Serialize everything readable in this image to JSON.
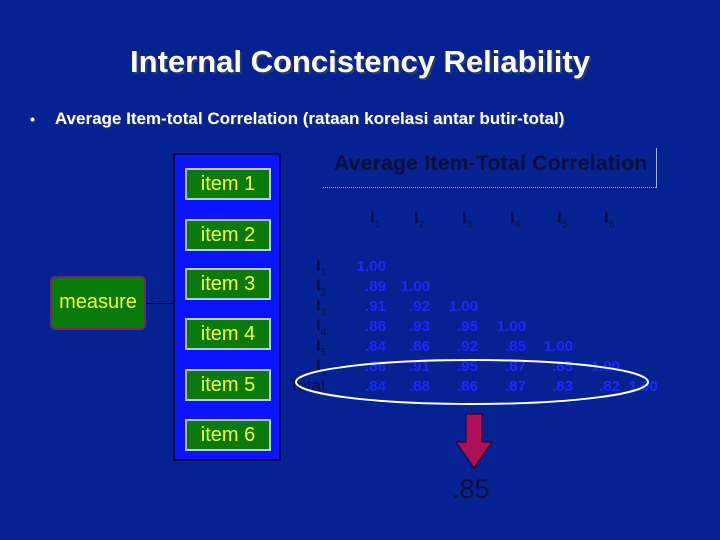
{
  "slide": {
    "title": "Internal Concistency Reliability",
    "bullet_marker": "•",
    "bullet_text": "Average Item-total Correlation (rataan korelasi antar butir-total)"
  },
  "diagram": {
    "measure_label": "measure",
    "items": [
      "item 1",
      "item 2",
      "item 3",
      "item 4",
      "item 5",
      "item 6"
    ]
  },
  "table": {
    "title": "Average Item-Total Correlation",
    "columns": [
      {
        "letter": "I",
        "sub": "1"
      },
      {
        "letter": "I",
        "sub": "2"
      },
      {
        "letter": "I",
        "sub": "3"
      },
      {
        "letter": "I",
        "sub": "4"
      },
      {
        "letter": "I",
        "sub": "5"
      },
      {
        "letter": "I",
        "sub": "6"
      }
    ],
    "rows": [
      {
        "letter": "I",
        "sub": "1",
        "values": [
          "1.00"
        ]
      },
      {
        "letter": "I",
        "sub": "2",
        "values": [
          ".89",
          "1.00"
        ]
      },
      {
        "letter": "I",
        "sub": "3",
        "values": [
          ".91",
          ".92",
          "1.00"
        ]
      },
      {
        "letter": "I",
        "sub": "4",
        "values": [
          ".88",
          ".93",
          ".95",
          "1.00"
        ]
      },
      {
        "letter": "I",
        "sub": "5",
        "values": [
          ".84",
          ".86",
          ".92",
          ".85",
          "1.00"
        ]
      },
      {
        "letter": "I",
        "sub": "6",
        "values": [
          ".88",
          ".91",
          ".95",
          ".87",
          ".85",
          "1.00"
        ]
      }
    ],
    "total_label": "Total",
    "total_values": [
      ".84",
      ".88",
      ".86",
      ".87",
      ".83",
      ".82",
      "1.00"
    ],
    "average_result": ".85"
  },
  "colors": {
    "background": "#062191",
    "items_panel": "#0a14ff",
    "item_box": "#0a7a0a",
    "item_text": "#f4ff3c",
    "cell_text": "#1d28ff",
    "arrow": "#b0105a"
  }
}
